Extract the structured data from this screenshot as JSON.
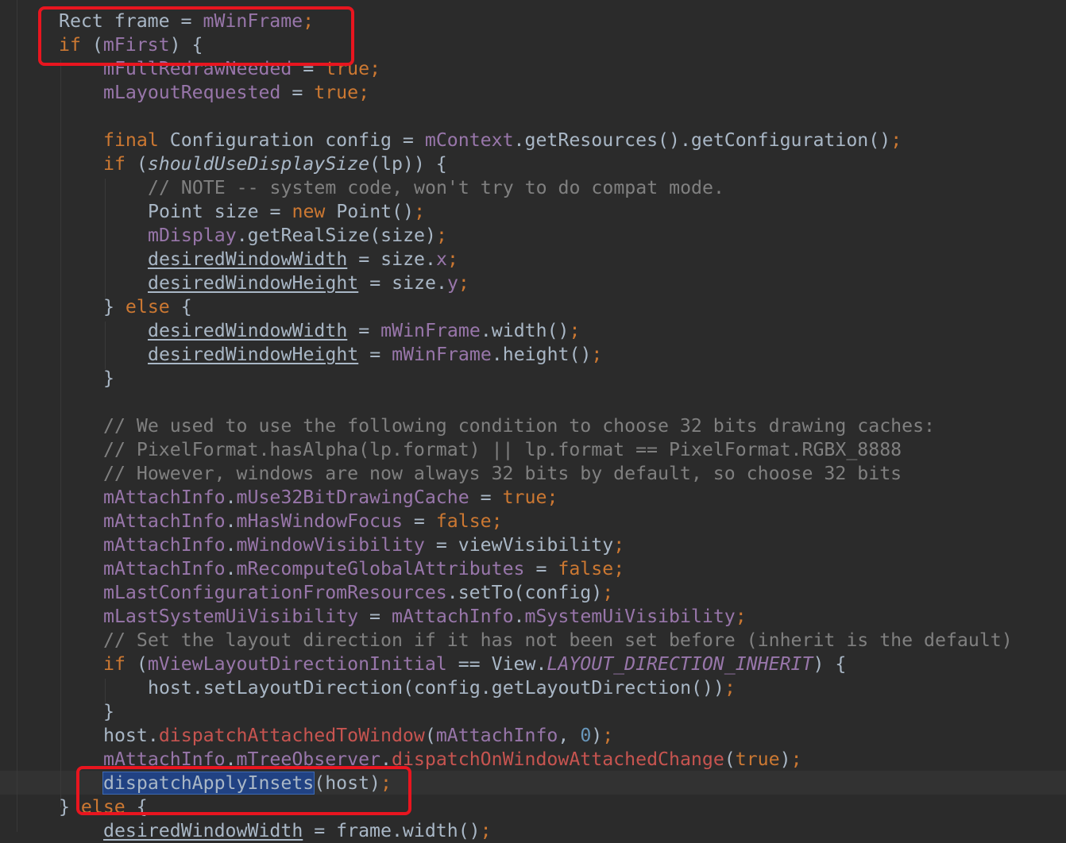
{
  "editor": {
    "language": "java",
    "colors": {
      "background": "#2b2b2b",
      "default": "#a9b7c6",
      "keyword": "#cc7832",
      "field": "#9876aa",
      "comment": "#808080",
      "number": "#6897bb",
      "method_decl": "#ffc66d",
      "unresolved": "#c75450",
      "selection": "#214283",
      "annotation_box": "#e8151f"
    },
    "lines": [
      {
        "indent": 1,
        "tokens": [
          {
            "t": "Rect frame = "
          },
          {
            "t": "mWinFrame",
            "c": "f"
          },
          {
            "t": ";",
            "c": "kw"
          }
        ]
      },
      {
        "indent": 1,
        "tokens": [
          {
            "t": "if",
            "c": "kw"
          },
          {
            "t": " ("
          },
          {
            "t": "mFirst",
            "c": "f"
          },
          {
            "t": ") {"
          }
        ]
      },
      {
        "indent": 2,
        "tokens": [
          {
            "t": "mFullRedrawNeeded",
            "c": "f"
          },
          {
            "t": " = "
          },
          {
            "t": "true",
            "c": "kw"
          },
          {
            "t": ";",
            "c": "kw"
          }
        ]
      },
      {
        "indent": 2,
        "tokens": [
          {
            "t": "mLayoutRequested",
            "c": "f"
          },
          {
            "t": " = "
          },
          {
            "t": "true",
            "c": "kw"
          },
          {
            "t": ";",
            "c": "kw"
          }
        ]
      },
      {
        "indent": 0,
        "tokens": []
      },
      {
        "indent": 2,
        "tokens": [
          {
            "t": "final",
            "c": "kw"
          },
          {
            "t": " Configuration config = "
          },
          {
            "t": "mContext",
            "c": "f"
          },
          {
            "t": ".getResources().getConfiguration()"
          },
          {
            "t": ";",
            "c": "kw"
          }
        ]
      },
      {
        "indent": 2,
        "tokens": [
          {
            "t": "if",
            "c": "kw"
          },
          {
            "t": " ("
          },
          {
            "t": "shouldUseDisplaySize",
            "c": "i"
          },
          {
            "t": "(lp)) {"
          }
        ]
      },
      {
        "indent": 3,
        "tokens": [
          {
            "t": "// NOTE -- system code, won't try to do compat mode.",
            "c": "c"
          }
        ]
      },
      {
        "indent": 3,
        "tokens": [
          {
            "t": "Point size = "
          },
          {
            "t": "new",
            "c": "kw"
          },
          {
            "t": " Point()"
          },
          {
            "t": ";",
            "c": "kw"
          }
        ]
      },
      {
        "indent": 3,
        "tokens": [
          {
            "t": "mDisplay",
            "c": "f"
          },
          {
            "t": ".getRealSize(size)"
          },
          {
            "t": ";",
            "c": "kw"
          }
        ]
      },
      {
        "indent": 3,
        "tokens": [
          {
            "t": "desiredWindowWidth",
            "c": "u"
          },
          {
            "t": " = size."
          },
          {
            "t": "x",
            "c": "f"
          },
          {
            "t": ";",
            "c": "kw"
          }
        ]
      },
      {
        "indent": 3,
        "tokens": [
          {
            "t": "desiredWindowHeight",
            "c": "u"
          },
          {
            "t": " = size."
          },
          {
            "t": "y",
            "c": "f"
          },
          {
            "t": ";",
            "c": "kw"
          }
        ]
      },
      {
        "indent": 2,
        "tokens": [
          {
            "t": "} "
          },
          {
            "t": "else",
            "c": "kw"
          },
          {
            "t": " {"
          }
        ]
      },
      {
        "indent": 3,
        "tokens": [
          {
            "t": "desiredWindowWidth",
            "c": "u"
          },
          {
            "t": " = "
          },
          {
            "t": "mWinFrame",
            "c": "f"
          },
          {
            "t": ".width()"
          },
          {
            "t": ";",
            "c": "kw"
          }
        ]
      },
      {
        "indent": 3,
        "tokens": [
          {
            "t": "desiredWindowHeight",
            "c": "u"
          },
          {
            "t": " = "
          },
          {
            "t": "mWinFrame",
            "c": "f"
          },
          {
            "t": ".height()"
          },
          {
            "t": ";",
            "c": "kw"
          }
        ]
      },
      {
        "indent": 2,
        "tokens": [
          {
            "t": "}"
          }
        ]
      },
      {
        "indent": 0,
        "tokens": []
      },
      {
        "indent": 2,
        "tokens": [
          {
            "t": "// We used to use the following condition to choose 32 bits drawing caches:",
            "c": "c"
          }
        ]
      },
      {
        "indent": 2,
        "tokens": [
          {
            "t": "// PixelFormat.hasAlpha(lp.format) || lp.format == PixelFormat.RGBX_8888",
            "c": "c"
          }
        ]
      },
      {
        "indent": 2,
        "tokens": [
          {
            "t": "// However, windows are now always 32 bits by default, so choose 32 bits",
            "c": "c"
          }
        ]
      },
      {
        "indent": 2,
        "tokens": [
          {
            "t": "mAttachInfo",
            "c": "f"
          },
          {
            "t": "."
          },
          {
            "t": "mUse32BitDrawingCache",
            "c": "f"
          },
          {
            "t": " = "
          },
          {
            "t": "true",
            "c": "kw"
          },
          {
            "t": ";",
            "c": "kw"
          }
        ]
      },
      {
        "indent": 2,
        "tokens": [
          {
            "t": "mAttachInfo",
            "c": "f"
          },
          {
            "t": "."
          },
          {
            "t": "mHasWindowFocus",
            "c": "f"
          },
          {
            "t": " = "
          },
          {
            "t": "false",
            "c": "kw"
          },
          {
            "t": ";",
            "c": "kw"
          }
        ]
      },
      {
        "indent": 2,
        "tokens": [
          {
            "t": "mAttachInfo",
            "c": "f"
          },
          {
            "t": "."
          },
          {
            "t": "mWindowVisibility",
            "c": "f"
          },
          {
            "t": " = viewVisibility"
          },
          {
            "t": ";",
            "c": "kw"
          }
        ]
      },
      {
        "indent": 2,
        "tokens": [
          {
            "t": "mAttachInfo",
            "c": "f"
          },
          {
            "t": "."
          },
          {
            "t": "mRecomputeGlobalAttributes",
            "c": "f"
          },
          {
            "t": " = "
          },
          {
            "t": "false",
            "c": "kw"
          },
          {
            "t": ";",
            "c": "kw"
          }
        ]
      },
      {
        "indent": 2,
        "tokens": [
          {
            "t": "mLastConfigurationFromResources",
            "c": "f"
          },
          {
            "t": ".setTo(config)"
          },
          {
            "t": ";",
            "c": "kw"
          }
        ]
      },
      {
        "indent": 2,
        "tokens": [
          {
            "t": "mLastSystemUiVisibility",
            "c": "f"
          },
          {
            "t": " = "
          },
          {
            "t": "mAttachInfo",
            "c": "f"
          },
          {
            "t": "."
          },
          {
            "t": "mSystemUiVisibility",
            "c": "f"
          },
          {
            "t": ";",
            "c": "kw"
          }
        ]
      },
      {
        "indent": 2,
        "tokens": [
          {
            "t": "// Set the layout direction if it has not been set before (inherit is the default)",
            "c": "c"
          }
        ]
      },
      {
        "indent": 2,
        "tokens": [
          {
            "t": "if",
            "c": "kw"
          },
          {
            "t": " ("
          },
          {
            "t": "mViewLayoutDirectionInitial",
            "c": "f"
          },
          {
            "t": " == View."
          },
          {
            "t": "LAYOUT_DIRECTION_INHERIT",
            "c": "fi"
          },
          {
            "t": ") {"
          }
        ]
      },
      {
        "indent": 3,
        "tokens": [
          {
            "t": "host.setLayoutDirection(config.getLayoutDirection())"
          },
          {
            "t": ";",
            "c": "kw"
          }
        ]
      },
      {
        "indent": 2,
        "tokens": [
          {
            "t": "}"
          }
        ]
      },
      {
        "indent": 2,
        "tokens": [
          {
            "t": "host."
          },
          {
            "t": "dispatchAttachedToWindow",
            "c": "e"
          },
          {
            "t": "("
          },
          {
            "t": "mAttachInfo",
            "c": "f"
          },
          {
            "t": ", "
          },
          {
            "t": "0",
            "c": "n"
          },
          {
            "t": ")"
          },
          {
            "t": ";",
            "c": "kw"
          }
        ]
      },
      {
        "indent": 2,
        "tokens": [
          {
            "t": "mAttachInfo",
            "c": "f"
          },
          {
            "t": "."
          },
          {
            "t": "mTreeObserver",
            "c": "f"
          },
          {
            "t": "."
          },
          {
            "t": "dispatchOnWindowAttachedChange",
            "c": "e"
          },
          {
            "t": "("
          },
          {
            "t": "true",
            "c": "kw"
          },
          {
            "t": ")"
          },
          {
            "t": ";",
            "c": "kw"
          }
        ]
      },
      {
        "indent": 2,
        "tokens": [
          {
            "t": "dispatchApplyInsets",
            "c": "sel"
          },
          {
            "t": "(host)"
          },
          {
            "t": ";",
            "c": "kw"
          }
        ]
      },
      {
        "indent": 1,
        "tokens": [
          {
            "t": "} "
          },
          {
            "t": "else",
            "c": "kw"
          },
          {
            "t": " {"
          }
        ]
      },
      {
        "indent": 2,
        "tokens": [
          {
            "t": "desiredWindowWidth",
            "c": "u"
          },
          {
            "t": " = frame.width()"
          },
          {
            "t": ";",
            "c": "kw"
          }
        ]
      }
    ]
  }
}
